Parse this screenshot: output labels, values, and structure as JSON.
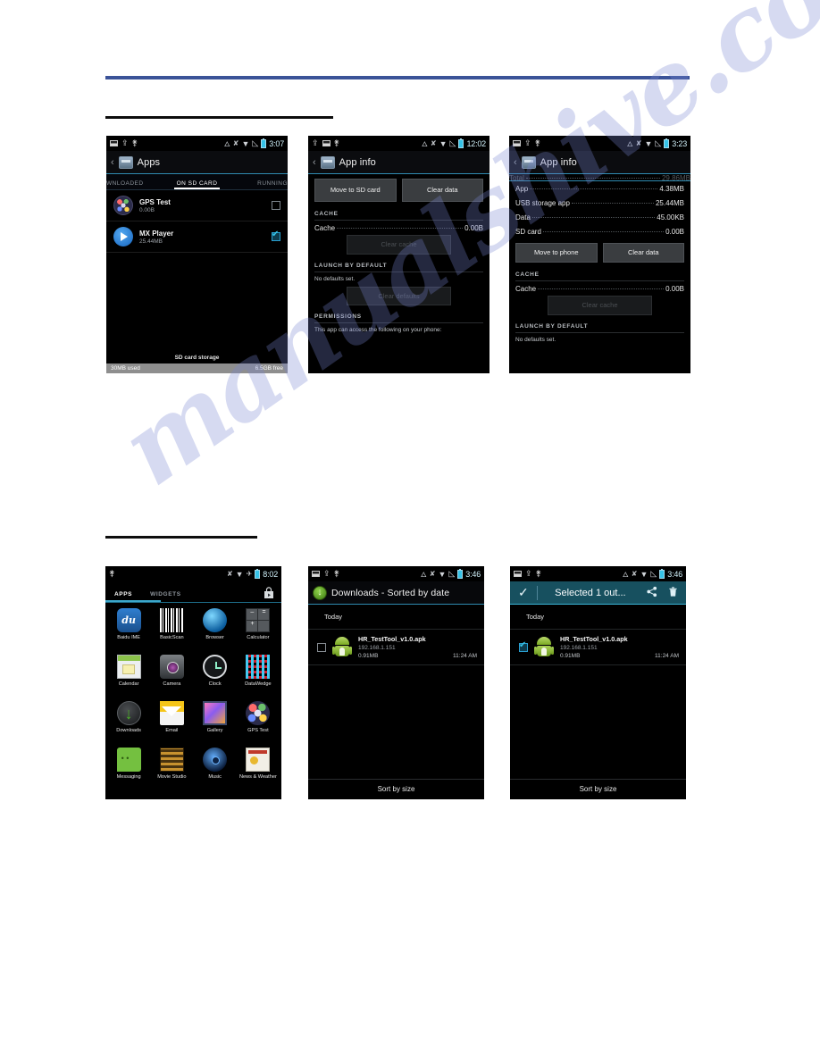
{
  "page": {
    "watermark_text": "manualshive.com",
    "rule_color_blue": "#3b5398",
    "rule_color_black": "#0d0d0d"
  },
  "screens": {
    "apps_on_sd": {
      "statusbar": {
        "left_icons": [
          "screenshot-icon",
          "upload-icon",
          "usb-icon"
        ],
        "right_icons": [
          "bluetooth-icon",
          "vibrate-icon",
          "wifi-icon",
          "signal-icon",
          "battery-icon"
        ],
        "clock": "3:07"
      },
      "actionbar": {
        "back": "‹",
        "app_icon": "apps-settings-icon",
        "title": "Apps"
      },
      "tabs": [
        {
          "label": "WNLOADED",
          "active": false
        },
        {
          "label": "ON SD CARD",
          "active": true
        },
        {
          "label": "RUNNING",
          "active": false
        }
      ],
      "rows": [
        {
          "name": "GPS Test",
          "size": "0.00B",
          "icon": "gps-test-icon",
          "checked": false
        },
        {
          "name": "MX Player",
          "size": "25.44MB",
          "icon": "mx-player-icon",
          "checked": true
        }
      ],
      "footer": {
        "title": "SD card storage",
        "used": "30MB used",
        "free": "6.5GB free"
      }
    },
    "app_info_move_to_sd": {
      "statusbar": {
        "left_icons": [
          "upload-icon",
          "screenshot-icon",
          "usb-icon"
        ],
        "right_icons": [
          "bluetooth-icon",
          "vibrate-icon",
          "wifi-icon",
          "signal-icon",
          "battery-icon"
        ],
        "clock": "12:02"
      },
      "actionbar": {
        "back": "‹",
        "app_icon": "apps-settings-icon",
        "title": "App info"
      },
      "buttons": [
        {
          "label": "Move to SD card",
          "disabled": false
        },
        {
          "label": "Clear data",
          "disabled": false
        }
      ],
      "cache_section": {
        "heading": "CACHE",
        "key": "Cache",
        "value": "0.00B",
        "button": "Clear cache",
        "button_disabled": true
      },
      "launch_section": {
        "heading": "LAUNCH BY DEFAULT",
        "text": "No defaults set.",
        "button": "Clear defaults",
        "button_disabled": true
      },
      "permissions_section": {
        "heading": "PERMISSIONS",
        "text": "This app can access the following on your phone:"
      }
    },
    "app_info_move_to_phone": {
      "statusbar": {
        "left_icons": [
          "screenshot-icon",
          "upload-icon",
          "usb-icon"
        ],
        "right_icons": [
          "bluetooth-icon",
          "vibrate-icon",
          "wifi-icon",
          "signal-icon",
          "battery-icon"
        ],
        "clock": "3:23"
      },
      "actionbar": {
        "back": "‹",
        "app_icon": "apps-settings-icon",
        "title": "App info"
      },
      "storage_rows": [
        {
          "key": "App",
          "value": "4.38MB"
        },
        {
          "key": "USB storage app",
          "value": "25.44MB"
        },
        {
          "key": "Data",
          "value": "45.00KB"
        },
        {
          "key": "SD card",
          "value": "0.00B"
        }
      ],
      "buttons": [
        {
          "label": "Move to phone",
          "disabled": false
        },
        {
          "label": "Clear data",
          "disabled": false
        }
      ],
      "cache_section": {
        "heading": "CACHE",
        "key": "Cache",
        "value": "0.00B",
        "button": "Clear cache",
        "button_disabled": true
      },
      "launch_section": {
        "heading": "LAUNCH BY DEFAULT",
        "text": "No defaults set."
      }
    },
    "app_drawer": {
      "statusbar": {
        "left_icons": [
          "usb-icon"
        ],
        "right_icons": [
          "vibrate-icon",
          "wifi-icon",
          "airplane-icon",
          "battery-icon"
        ],
        "clock": "8:02"
      },
      "tabs": [
        {
          "label": "APPS",
          "active": true
        },
        {
          "label": "WIDGETS",
          "active": false
        }
      ],
      "shop_icon": "play-store-bag-icon",
      "apps": [
        {
          "label": "Baidu IME",
          "icon": "baidu-ime-icon"
        },
        {
          "label": "BasicScan",
          "icon": "basicscan-barcode-icon"
        },
        {
          "label": "Browser",
          "icon": "browser-globe-icon"
        },
        {
          "label": "Calculator",
          "icon": "calculator-icon"
        },
        {
          "label": "Calendar",
          "icon": "calendar-icon"
        },
        {
          "label": "Camera",
          "icon": "camera-icon"
        },
        {
          "label": "Clock",
          "icon": "clock-icon"
        },
        {
          "label": "DataWedge",
          "icon": "datawedge-qr-icon"
        },
        {
          "label": "Downloads",
          "icon": "downloads-icon"
        },
        {
          "label": "Email",
          "icon": "email-envelope-icon"
        },
        {
          "label": "Gallery",
          "icon": "gallery-icon"
        },
        {
          "label": "GPS Test",
          "icon": "gps-test-icon"
        },
        {
          "label": "Messaging",
          "icon": "messaging-icon"
        },
        {
          "label": "Movie Studio",
          "icon": "movie-studio-icon"
        },
        {
          "label": "Music",
          "icon": "music-icon"
        },
        {
          "label": "News & Weather",
          "icon": "news-weather-icon"
        }
      ]
    },
    "downloads": {
      "statusbar": {
        "left_icons": [
          "screenshot-icon",
          "upload-icon",
          "usb-icon"
        ],
        "right_icons": [
          "bluetooth-icon",
          "vibrate-icon",
          "wifi-icon",
          "signal-icon",
          "battery-icon"
        ],
        "clock": "3:46"
      },
      "actionbar": {
        "icon": "downloads-icon",
        "title": "Downloads - Sorted by date"
      },
      "group_label": "Today",
      "items": [
        {
          "filename": "HR_TestTool_v1.0.apk",
          "source": "192.168.1.151",
          "size": "0.91MB",
          "time": "11:24 AM",
          "icon": "android-apk-icon",
          "checked": false
        }
      ],
      "footer_button": "Sort by size"
    },
    "downloads_selected": {
      "statusbar": {
        "left_icons": [
          "screenshot-icon",
          "upload-icon",
          "usb-icon"
        ],
        "right_icons": [
          "bluetooth-icon",
          "vibrate-icon",
          "wifi-icon",
          "signal-icon",
          "battery-icon"
        ],
        "clock": "3:46"
      },
      "actionbar": {
        "done_icon": "checkmark-icon",
        "title": "Selected 1 out...",
        "share_icon": "share-icon",
        "delete_icon": "trash-icon",
        "accent": "#17505f"
      },
      "group_label": "Today",
      "items": [
        {
          "filename": "HR_TestTool_v1.0.apk",
          "source": "192.168.1.151",
          "size": "0.91MB",
          "time": "11:24 AM",
          "icon": "android-apk-icon",
          "checked": true
        }
      ],
      "footer_button": "Sort by size"
    }
  }
}
